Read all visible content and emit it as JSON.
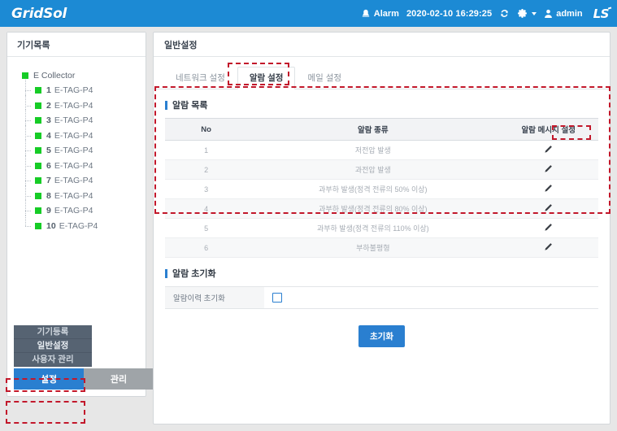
{
  "header": {
    "brand": "GridSol",
    "alarm_label": "Alarm",
    "datetime": "2020-02-10 16:29:25",
    "user": "admin",
    "logo": "LS",
    "icons": {
      "alarm": "alarm-bell-icon",
      "refresh": "refresh-icon",
      "settings": "gear-icon",
      "user": "user-icon"
    },
    "accent_color": "#1c8ad4"
  },
  "sidebar": {
    "title": "기기목록",
    "tree": {
      "root": "E Collector",
      "children": [
        {
          "index": "1",
          "label": "E-TAG-P4"
        },
        {
          "index": "2",
          "label": "E-TAG-P4"
        },
        {
          "index": "3",
          "label": "E-TAG-P4"
        },
        {
          "index": "4",
          "label": "E-TAG-P4"
        },
        {
          "index": "5",
          "label": "E-TAG-P4"
        },
        {
          "index": "6",
          "label": "E-TAG-P4"
        },
        {
          "index": "7",
          "label": "E-TAG-P4"
        },
        {
          "index": "8",
          "label": "E-TAG-P4"
        },
        {
          "index": "9",
          "label": "E-TAG-P4"
        },
        {
          "index": "10",
          "label": "E-TAG-P4"
        }
      ],
      "node_color": "#16cc26"
    },
    "nav_items": [
      {
        "label": "기기등록",
        "selected": false
      },
      {
        "label": "일반설정",
        "selected": true
      },
      {
        "label": "사용자 관리",
        "selected": false
      }
    ],
    "bottom_tabs": [
      {
        "label": "설정",
        "active": true
      },
      {
        "label": "관리",
        "active": false
      }
    ]
  },
  "main": {
    "panel_title": "일반설정",
    "tabs": [
      {
        "label": "네트워크 설정",
        "active": false
      },
      {
        "label": "알람 설정",
        "active": true
      },
      {
        "label": "메일 설정",
        "active": false
      }
    ],
    "alarm_list": {
      "section_title": "알람 목록",
      "columns": [
        "No",
        "알람 종류",
        "알람 메시지 설정"
      ],
      "rows": [
        {
          "no": "1",
          "type": "저전압 발생",
          "action_icon": "pencil-icon"
        },
        {
          "no": "2",
          "type": "과전압 발생",
          "action_icon": "pencil-icon"
        },
        {
          "no": "3",
          "type": "과부하 발생(정격 전류의 50% 이상)",
          "action_icon": "pencil-icon"
        },
        {
          "no": "4",
          "type": "과부하 발생(정격 전류의 80% 이상)",
          "action_icon": "pencil-icon"
        },
        {
          "no": "5",
          "type": "과부하 발생(정격 전류의 110% 이상)",
          "action_icon": "pencil-icon"
        },
        {
          "no": "6",
          "type": "부하불평형",
          "action_icon": "pencil-icon"
        }
      ]
    },
    "alarm_reset": {
      "section_title": "알람 초기화",
      "field_label": "알람이력 초기화",
      "checkbox_checked": false,
      "button_label": "초기화"
    }
  },
  "annotations": {
    "highlight_color": "#c2182b",
    "style": "dashed"
  }
}
